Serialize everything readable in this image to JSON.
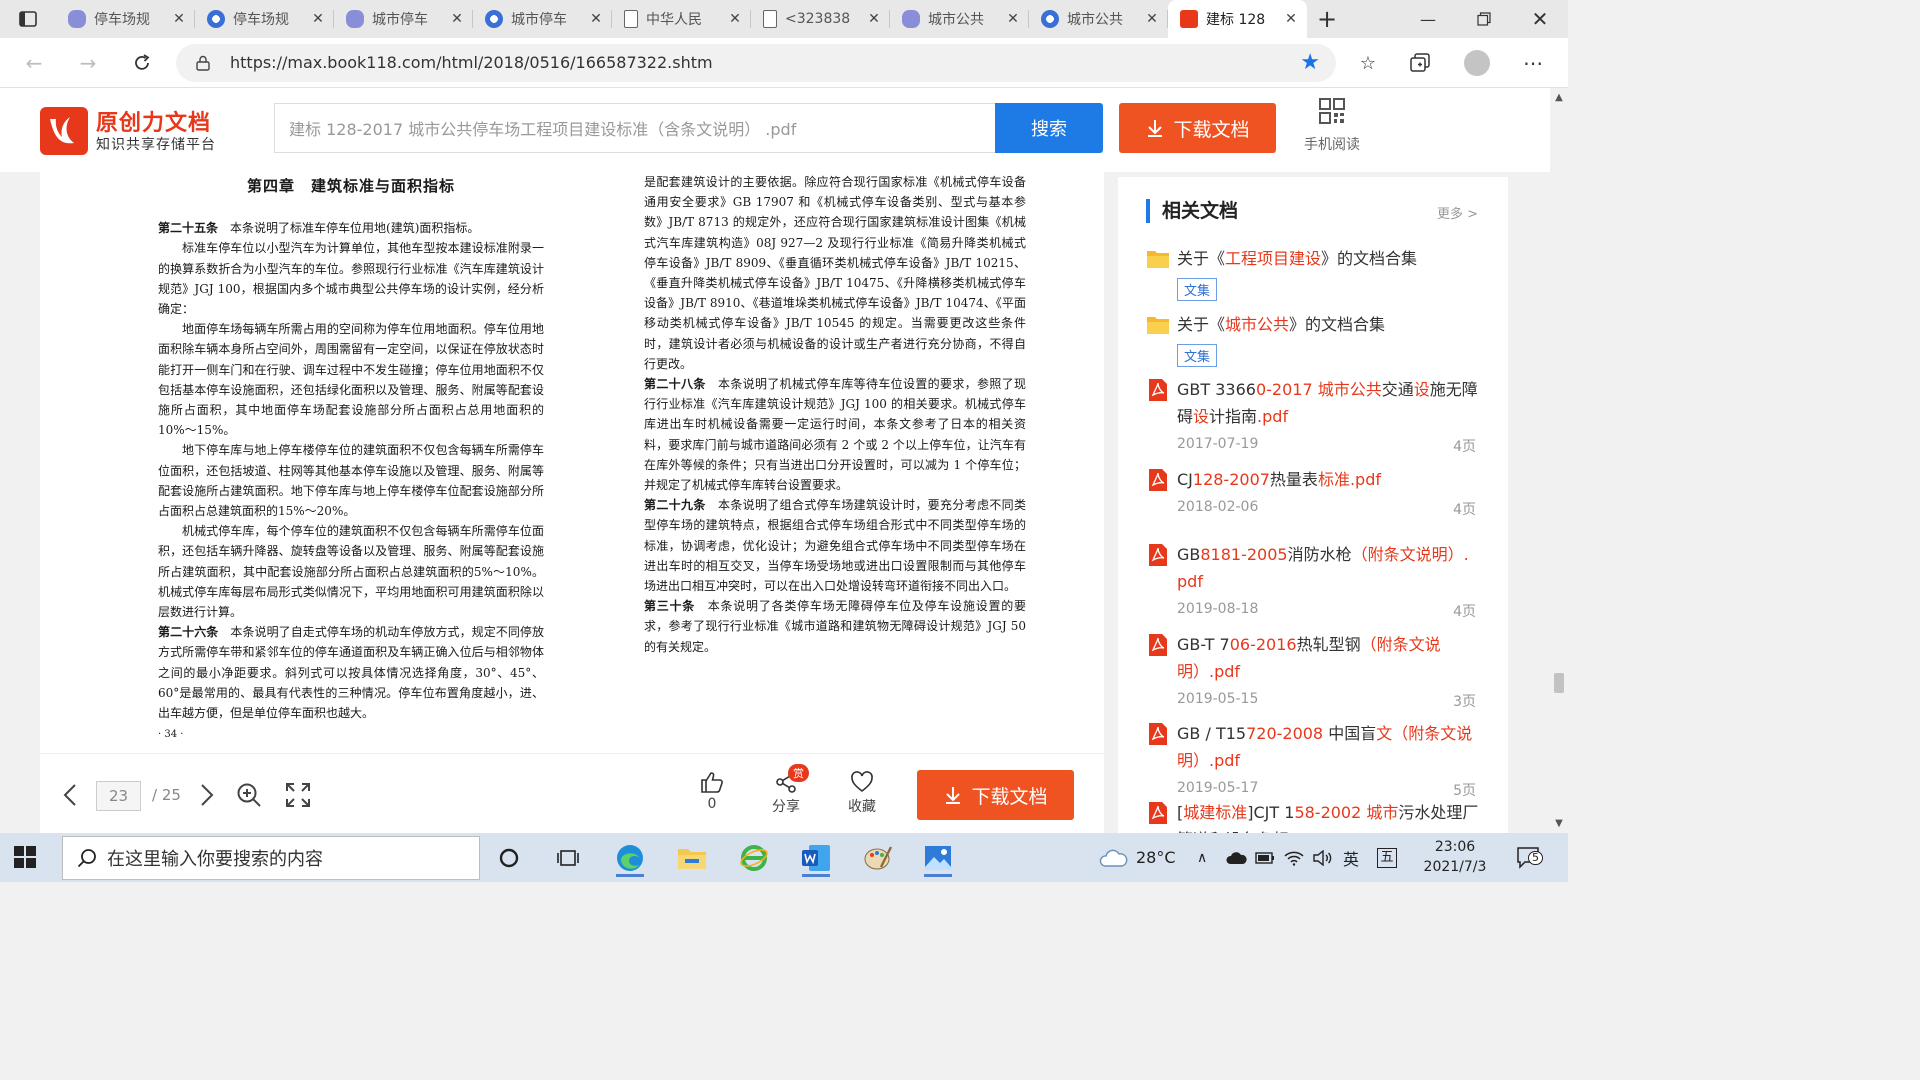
{
  "browser": {
    "tabs": [
      {
        "title": "停车场规",
        "icon": "paw-icon"
      },
      {
        "title": "停车场规",
        "icon": "globe-icon"
      },
      {
        "title": "城市停车",
        "icon": "paw-icon"
      },
      {
        "title": "城市停车",
        "icon": "globe-icon"
      },
      {
        "title": "中华人民",
        "icon": "document-icon"
      },
      {
        "title": "<323838",
        "icon": "document-icon"
      },
      {
        "title": "城市公共",
        "icon": "paw-icon"
      },
      {
        "title": "城市公共",
        "icon": "globe-icon"
      },
      {
        "title": "建标 128",
        "icon": "brand-icon",
        "active": true
      }
    ],
    "url": "https://max.book118.com/html/2018/0516/166587322.shtm"
  },
  "site": {
    "logo_name": "原创力文档",
    "logo_sub": "知识共享存储平台",
    "search_value": "建标 128-2017 城市公共停车场工程项目建设标准（含条文说明） .pdf",
    "search_button": "搜索",
    "download_button": "下载文档",
    "mobile_read": "手机阅读"
  },
  "document": {
    "chapter_title": "第四章　建筑标准与面积指标",
    "left_paragraphs": [
      {
        "bold": "第二十五条",
        "text": "　本条说明了标准车停车位用地(建筑)面积指标。",
        "indent": false
      },
      {
        "bold": "",
        "text": "标准车停车位以小型汽车为计算单位，其他车型按本建设标准附录一的换算系数折合为小型汽车的车位。参照现行行业标准《汽车库建筑设计规范》JGJ 100，根据国内多个城市典型公共停车场的设计实例，经分析确定：",
        "indent": true
      },
      {
        "bold": "",
        "text": "地面停车场每辆车所需占用的空间称为停车位用地面积。停车位用地面积除车辆本身所占空间外，周围需留有一定空间，以保证在停放状态时能打开一侧车门和在行驶、调车过程中不发生碰撞；停车位用地面积不仅包括基本停车设施面积，还包括绿化面积以及管理、服务、附属等配套设施所占面积，其中地面停车场配套设施部分所占面积占总用地面积的10%～15%。",
        "indent": true
      },
      {
        "bold": "",
        "text": "地下停车库与地上停车楼停车位的建筑面积不仅包含每辆车所需停车位面积，还包括坡道、柱网等其他基本停车设施以及管理、服务、附属等配套设施所占建筑面积。地下停车库与地上停车楼停车位配套设施部分所占面积占总建筑面积的15%～20%。",
        "indent": true
      },
      {
        "bold": "",
        "text": "机械式停车库，每个停车位的建筑面积不仅包含每辆车所需停车位面积，还包括车辆升降器、旋转盘等设备以及管理、服务、附属等配套设施所占建筑面积，其中配套设施部分所占面积占总建筑面积的5%～10%。机械式停车库每层布局形式类似情况下，平均用地面积可用建筑面积除以层数进行计算。",
        "indent": true
      },
      {
        "bold": "第二十六条",
        "text": "　本条说明了自走式停车场的机动车停放方式，规定不同停放方式所需停车带和紧邻车位的停车通道面积及车辆正确入位后与相邻物体之间的最小净距要求。斜列式可以按具体情况选择角度，30°、45°、60°是最常用的、最具有代表性的三种情况。停车位布置角度越小，进、出车越方便，但是单位停车面积也越大。",
        "indent": false
      }
    ],
    "left_page_number": "· 34 ·",
    "right_paragraphs": [
      {
        "bold": "",
        "text": "是配套建筑设计的主要依据。除应符合现行国家标准《机械式停车设备通用安全要求》GB 17907 和《机械式停车设备类别、型式与基本参数》JB/T 8713 的规定外，还应符合现行国家建筑标准设计图集《机械式汽车库建筑构造》08J 927—2 及现行行业标准《简易升降类机械式停车设备》JB/T 8909、《垂直循环类机械式停车设备》JB/T 10215、《垂直升降类机械式停车设备》JB/T 10475、《升降横移类机械式停车设备》JB/T 8910、《巷道堆垛类机械式停车设备》JB/T 10474、《平面移动类机械式停车设备》JB/T 10545 的规定。当需要更改这些条件时，建筑设计者必须与机械设备的设计或生产者进行充分协商，不得自行更改。",
        "indent": false
      },
      {
        "bold": "第二十八条",
        "text": "　本条说明了机械式停车库等待车位设置的要求，参照了现行行业标准《汽车库建筑设计规范》JGJ 100 的相关要求。机械式停车库进出车时机械设备需要一定运行时间，本条文参考了日本的相关资料，要求库门前与城市道路间必须有 2 个或 2 个以上停车位，让汽车有在库外等候的条件；只有当进出口分开设置时，可以减为 1 个停车位；并规定了机械式停车库转台设置要求。",
        "indent": false
      },
      {
        "bold": "第二十九条",
        "text": "　本条说明了组合式停车场建筑设计时，要充分考虑不同类型停车场的建筑特点，根据组合式停车场组合形式中不同类型停车场的标准，协调考虑，优化设计；为避免组合式停车场中不同类型停车场在进出车时的相互交叉，当停车场受场地或进出口设置限制而与其他停车场进出口相互冲突时，可以在出入口处增设转弯环道衔接不同出入口。",
        "indent": false
      },
      {
        "bold": "第三十条",
        "text": "　本条说明了各类停车场无障碍停车位及停车设施设置的要求，参考了现行行业标准《城市道路和建筑物无障碍设计规范》JGJ 50 的有关规定。",
        "indent": false
      }
    ]
  },
  "viewer": {
    "current_page": "23",
    "total_pages": "/ 25",
    "like_count": "0",
    "share_label": "分享",
    "reward_badge": "赏",
    "favorite_label": "收藏",
    "download_button": "下载文档"
  },
  "sidebar": {
    "title": "相关文档",
    "more": "更多 >",
    "items": [
      {
        "type": "folder",
        "segments": [
          [
            "关于《",
            false
          ],
          [
            "工程项目建设",
            true
          ],
          [
            "》的文档合集",
            false
          ]
        ],
        "tag": "文集"
      },
      {
        "type": "folder",
        "segments": [
          [
            "关于《",
            false
          ],
          [
            "城市公共",
            true
          ],
          [
            "》的文档合集",
            false
          ]
        ],
        "tag": "文集"
      },
      {
        "type": "pdf",
        "segments": [
          [
            "GBT 3366",
            false
          ],
          [
            "0-2017 城市公共",
            true
          ],
          [
            "交通",
            false
          ],
          [
            "设",
            true
          ],
          [
            "施无障碍",
            false
          ],
          [
            "设",
            true
          ],
          [
            "计指南",
            false
          ],
          [
            ".pdf",
            true
          ]
        ],
        "date": "2017-07-19",
        "pages": "4页"
      },
      {
        "type": "pdf",
        "segments": [
          [
            "CJ",
            false
          ],
          [
            "128-2007",
            true
          ],
          [
            "热量表",
            false
          ],
          [
            "标准",
            true
          ],
          [
            ".pdf",
            true
          ]
        ],
        "date": "2018-02-06",
        "pages": "4页"
      },
      {
        "type": "pdf",
        "segments": [
          [
            "GB",
            false
          ],
          [
            "8181-2005",
            true
          ],
          [
            "消防水枪",
            false
          ],
          [
            "（附条文说明）",
            true
          ],
          [
            ". pdf",
            true
          ]
        ],
        "date": "2019-08-18",
        "pages": "4页"
      },
      {
        "type": "pdf",
        "segments": [
          [
            "GB-T 7",
            false
          ],
          [
            "06-2016",
            true
          ],
          [
            "热轧型钢",
            false
          ],
          [
            "（附条文说明）",
            true
          ],
          [
            ".pdf",
            true
          ]
        ],
        "date": "2019-05-15",
        "pages": "3页"
      },
      {
        "type": "pdf",
        "segments": [
          [
            "GB / T15",
            false
          ],
          [
            "720-2008",
            true
          ],
          [
            " 中国盲",
            false
          ],
          [
            "文（附条文说明）",
            true
          ],
          [
            ".pdf",
            true
          ]
        ],
        "date": "2019-05-17",
        "pages": "5页"
      },
      {
        "type": "pdf",
        "segments": [
          [
            "[",
            false
          ],
          [
            "城建标准",
            true
          ],
          [
            "]CJT 1",
            false
          ],
          [
            "58-2002 城市",
            true
          ],
          [
            "污水处理厂管道和设备色标",
            false
          ],
          [
            ".pdf",
            true
          ]
        ],
        "date": "",
        "pages": ""
      }
    ]
  },
  "taskbar": {
    "search_placeholder": "在这里输入你要搜索的内容",
    "weather": "28°C",
    "ime_lang": "英",
    "ime_mode": "五",
    "time": "23:06",
    "date": "2021/7/3",
    "notif_count": "5"
  },
  "colors": {
    "brand_red": "#e8381b",
    "download_orange": "#f05322",
    "search_blue": "#1e7be6"
  }
}
